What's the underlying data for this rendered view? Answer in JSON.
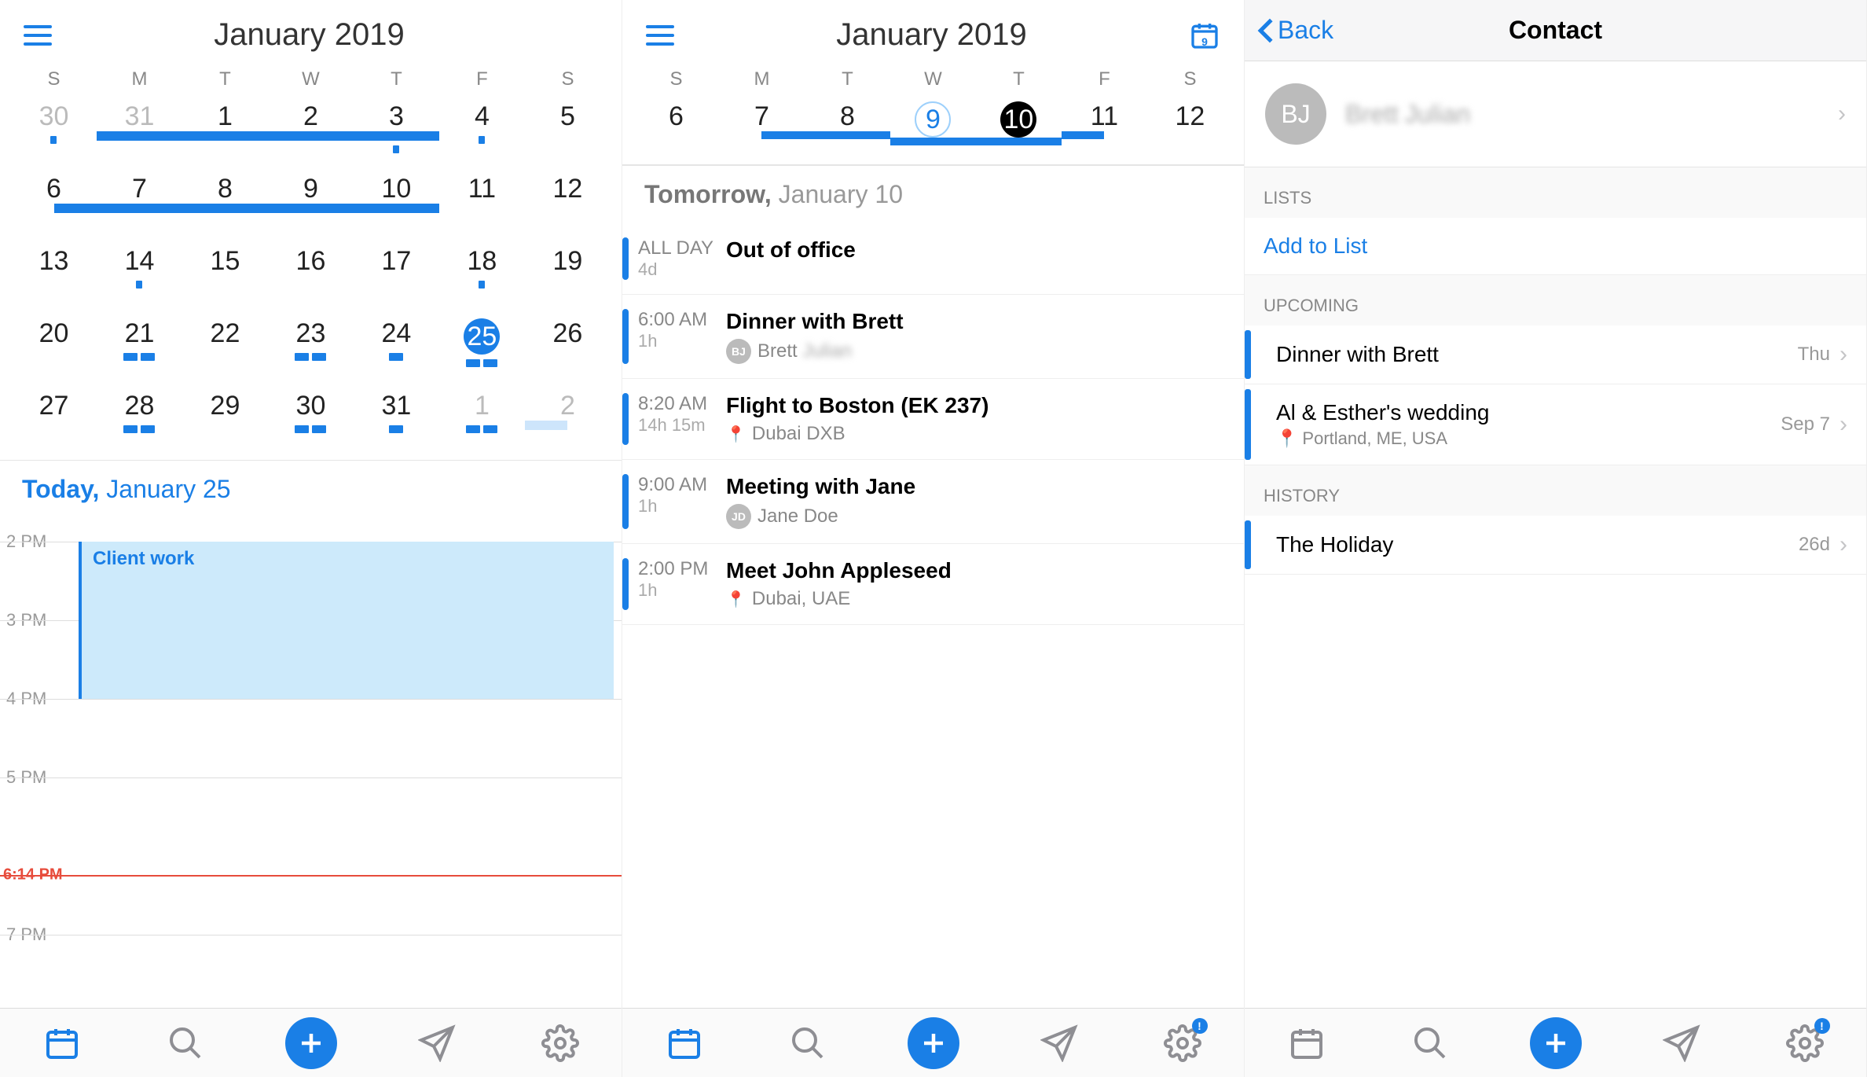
{
  "panel1": {
    "month_title": "January 2019",
    "weekdays": [
      "S",
      "M",
      "T",
      "W",
      "T",
      "F",
      "S"
    ],
    "days": [
      {
        "n": "30",
        "dim": true,
        "smallMark": true
      },
      {
        "n": "31",
        "dim": true,
        "bar": true
      },
      {
        "n": "1",
        "bar": true
      },
      {
        "n": "2",
        "bar": true
      },
      {
        "n": "3",
        "bar": true,
        "smallMark": true
      },
      {
        "n": "4",
        "smallMark": true
      },
      {
        "n": "5"
      },
      {
        "n": "6",
        "bar": true
      },
      {
        "n": "7",
        "bar": true
      },
      {
        "n": "8",
        "bar": true
      },
      {
        "n": "9",
        "bar": true
      },
      {
        "n": "10",
        "bar": true
      },
      {
        "n": "11"
      },
      {
        "n": "12"
      },
      {
        "n": "13"
      },
      {
        "n": "14",
        "smallMark": true
      },
      {
        "n": "15"
      },
      {
        "n": "16"
      },
      {
        "n": "17"
      },
      {
        "n": "18",
        "smallMark": true
      },
      {
        "n": "19"
      },
      {
        "n": "20"
      },
      {
        "n": "21",
        "marks": 2
      },
      {
        "n": "22"
      },
      {
        "n": "23",
        "marks": 2
      },
      {
        "n": "24",
        "marks": 1
      },
      {
        "n": "25",
        "sel": "blue",
        "marks": 2
      },
      {
        "n": "26"
      },
      {
        "n": "27"
      },
      {
        "n": "28",
        "marks": 2
      },
      {
        "n": "29"
      },
      {
        "n": "30",
        "marks": 2
      },
      {
        "n": "31",
        "marks": 1
      },
      {
        "n": "1",
        "dim": true,
        "marks": 2
      },
      {
        "n": "2",
        "dim": true,
        "dimbar": true
      }
    ],
    "agenda_label_prefix": "Today,",
    "agenda_label_date": "January 25",
    "hours": [
      "2 PM",
      "3 PM",
      "4 PM",
      "5 PM",
      "7 PM"
    ],
    "now_label": "6:14 PM",
    "event_title": "Client work"
  },
  "panel2": {
    "month_title": "January 2019",
    "today_icon_num": "9",
    "weekdays": [
      "S",
      "M",
      "T",
      "W",
      "T",
      "F",
      "S"
    ],
    "days_row": [
      {
        "n": "6"
      },
      {
        "n": "7",
        "bar": true
      },
      {
        "n": "8",
        "bar": true
      },
      {
        "n": "9",
        "outline": true,
        "bar": true
      },
      {
        "n": "10",
        "selblack": true,
        "bar": true
      },
      {
        "n": "11",
        "bar": true
      },
      {
        "n": "12"
      }
    ],
    "agenda_label_prefix": "Tomorrow,",
    "agenda_label_date": "January 10",
    "events": [
      {
        "time1": "ALL DAY",
        "time2": "4d",
        "title": "Out of office"
      },
      {
        "time1": "6:00 AM",
        "time2": "1h",
        "title": "Dinner with Brett",
        "attendee_initials": "BJ",
        "attendee_first": "Brett",
        "attendee_last": "Julian",
        "attendee_blur": true
      },
      {
        "time1": "8:20 AM",
        "time2": "14h 15m",
        "title": "Flight to Boston (EK 237)",
        "loc": "Dubai DXB"
      },
      {
        "time1": "9:00 AM",
        "time2": "1h",
        "title": "Meeting with Jane",
        "attendee_initials": "JD",
        "attendee_first": "Jane",
        "attendee_last": "Doe"
      },
      {
        "time1": "2:00 PM",
        "time2": "1h",
        "title": "Meet John Appleseed",
        "loc": "Dubai, UAE"
      }
    ]
  },
  "panel3": {
    "back_label": "Back",
    "title": "Contact",
    "avatar_initials": "BJ",
    "name_first": "Brett",
    "name_last": "Julian",
    "sections": {
      "lists_label": "LISTS",
      "add_to_list": "Add to List",
      "upcoming_label": "UPCOMING",
      "upcoming": [
        {
          "title": "Dinner with Brett",
          "date": "Thu"
        },
        {
          "title": "Al & Esther's wedding",
          "loc": "Portland, ME, USA",
          "date": "Sep 7"
        }
      ],
      "history_label": "HISTORY",
      "history": [
        {
          "title": "The Holiday",
          "date": "26d"
        }
      ]
    }
  },
  "tabbar": {
    "badge": "!"
  }
}
